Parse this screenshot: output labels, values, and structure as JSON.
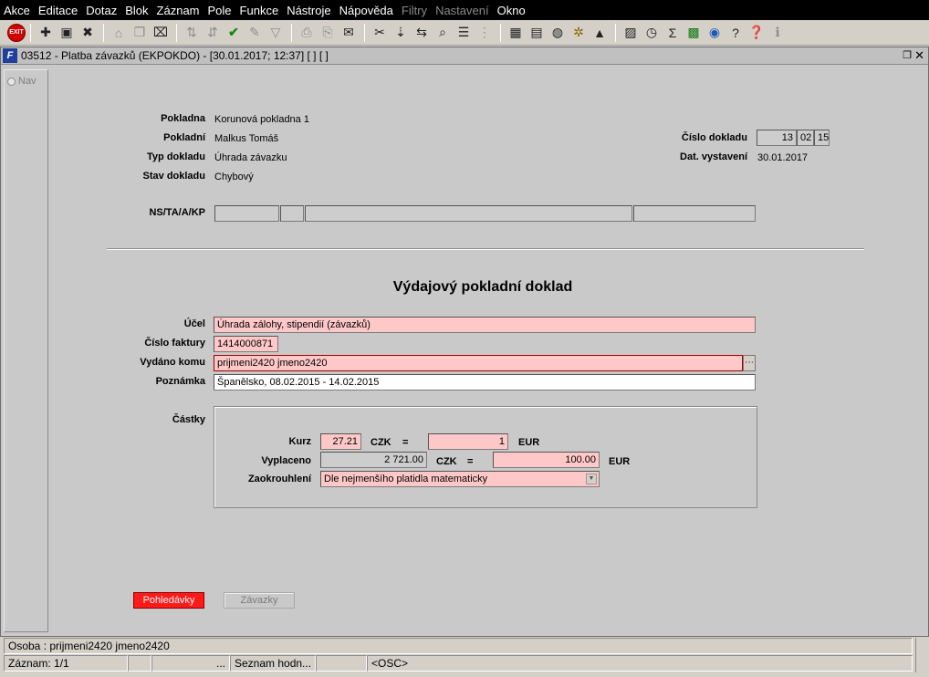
{
  "menu": [
    "Akce",
    "Editace",
    "Dotaz",
    "Blok",
    "Záznam",
    "Pole",
    "Funkce",
    "Nástroje",
    "Nápověda",
    "Filtry",
    "Nastavení",
    "Okno"
  ],
  "menu_disabled": [
    "Filtry",
    "Nastavení"
  ],
  "toolbar": {
    "exit_label": "EXIT",
    "icons": [
      "save-new-icon",
      "insert-record-icon",
      "delete-record-icon",
      "lock-icon",
      "copy-record-icon",
      "clear-icon",
      "sort-asc-icon",
      "sort-desc-icon",
      "check-icon",
      "tools-icon",
      "filter-icon",
      "print-icon",
      "print-preview-icon",
      "mail-icon",
      "cut-icon",
      "paste-icon",
      "link-icon",
      "find-icon",
      "list-icon",
      "tree-icon",
      "calendar-icon",
      "document-icon",
      "globe-icon",
      "settings-wheel-icon",
      "mountain-icon",
      "chart-icon",
      "clock-icon",
      "sum-icon",
      "excel-icon",
      "internet-icon",
      "help-icon",
      "question-icon",
      "info-icon"
    ]
  },
  "window": {
    "title": "03512 - Platba závazků (EKPOKDO) - [30.01.2017; 12:37] [ ] [ ]",
    "nav_label": "Nav"
  },
  "header": {
    "pokladna_label": "Pokladna",
    "pokladna_value": "Korunová pokladna 1",
    "pokladni_label": "Pokladní",
    "pokladni_value": "Malkus Tomáš",
    "typ_label": "Typ dokladu",
    "typ_value": "Úhrada závazku",
    "stav_label": "Stav dokladu",
    "stav_value": "Chybový",
    "cislo_label": "Číslo dokladu",
    "cislo_1": "13",
    "cislo_2": "02",
    "cislo_3": "15",
    "datum_label": "Dat. vystavení",
    "datum_value": "30.01.2017",
    "ns_label": "NS/TA/A/KP"
  },
  "doc": {
    "heading": "Výdajový pokladní doklad",
    "ucel_label": "Účel",
    "ucel_value": "Úhrada zálohy, stipendií  (závazků)",
    "faktura_label": "Číslo faktury",
    "faktura_value": "1414000871",
    "komu_label": "Vydáno komu",
    "komu_value": "prijmeni2420 jmeno2420",
    "poznamka_label": "Poznámka",
    "poznamka_value": "Španělsko, 08.02.2015 - 14.02.2015"
  },
  "castky": {
    "title": "Částky",
    "kurz_label": "Kurz",
    "kurz_value": "27.21",
    "kurz_cur": "CZK",
    "eq1": "=",
    "kurz_target": "1",
    "kurz_target_cur": "EUR",
    "vyplaceno_label": "Vyplaceno",
    "vyplaceno_value": "2 721.00",
    "vyplaceno_cur": "CZK",
    "eq2": "=",
    "vyplaceno_eur": "100.00",
    "vyplaceno_eur_cur": "EUR",
    "zaokrouhleni_label": "Zaokrouhlení",
    "zaokrouhleni_value": "Dle nejmenšího platidla matematicky"
  },
  "buttons": {
    "pohledavky": "Pohledávky",
    "zavazky": "Závazky"
  },
  "status": {
    "osoba": "Osoba : prijmeni2420 jmeno2420",
    "zaznam": "Záznam: 1/1",
    "cell3": "...",
    "seznam": "Seznam hodn...",
    "osc": "<OSC>"
  }
}
